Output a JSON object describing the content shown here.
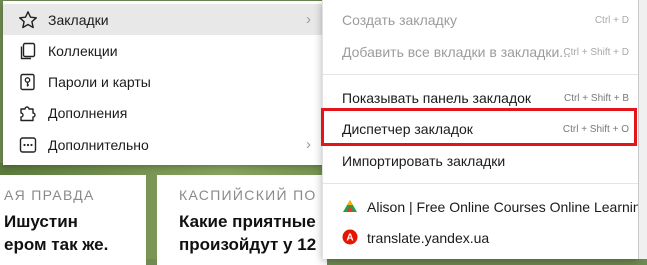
{
  "background": {
    "cards": [
      {
        "source": "АЯ ПРАВДА",
        "headline": [
          "Ишустин",
          "ером так же."
        ]
      },
      {
        "source": "КАСПИЙСКИЙ ПО",
        "headline": [
          "Какие приятные",
          "произойдут у 12"
        ]
      }
    ]
  },
  "main_menu": {
    "items": [
      {
        "label": "Закладки",
        "icon": "star-icon",
        "has_submenu": true,
        "active": true
      },
      {
        "label": "Коллекции",
        "icon": "collections-icon",
        "has_submenu": false
      },
      {
        "label": "Пароли и карты",
        "icon": "key-icon",
        "has_submenu": false
      },
      {
        "label": "Дополнения",
        "icon": "puzzle-icon",
        "has_submenu": false
      },
      {
        "label": "Дополнительно",
        "icon": "more-icon",
        "has_submenu": true
      }
    ],
    "chevron": "›"
  },
  "bookmarks_submenu": {
    "items": [
      {
        "label": "Создать закладку",
        "shortcut": "Ctrl + D",
        "disabled": true
      },
      {
        "label": "Добавить все вкладки в закладки...",
        "shortcut": "Ctrl + Shift + D",
        "disabled": true
      },
      {
        "label": "Показывать панель закладок",
        "shortcut": "Ctrl + Shift + B"
      },
      {
        "label": "Диспетчер закладок",
        "shortcut": "Ctrl + Shift + O",
        "highlighted": true
      },
      {
        "label": "Импортировать закладки",
        "shortcut": ""
      }
    ],
    "bookmarks": [
      {
        "label": "Alison | Free Online Courses  Online Learning",
        "icon": "alison-favicon"
      },
      {
        "label": "translate.yandex.ua",
        "icon": "yandex-translate-favicon"
      }
    ]
  },
  "colors": {
    "highlight_border": "#e3141a",
    "active_item_bg": "#e8e8e8"
  }
}
